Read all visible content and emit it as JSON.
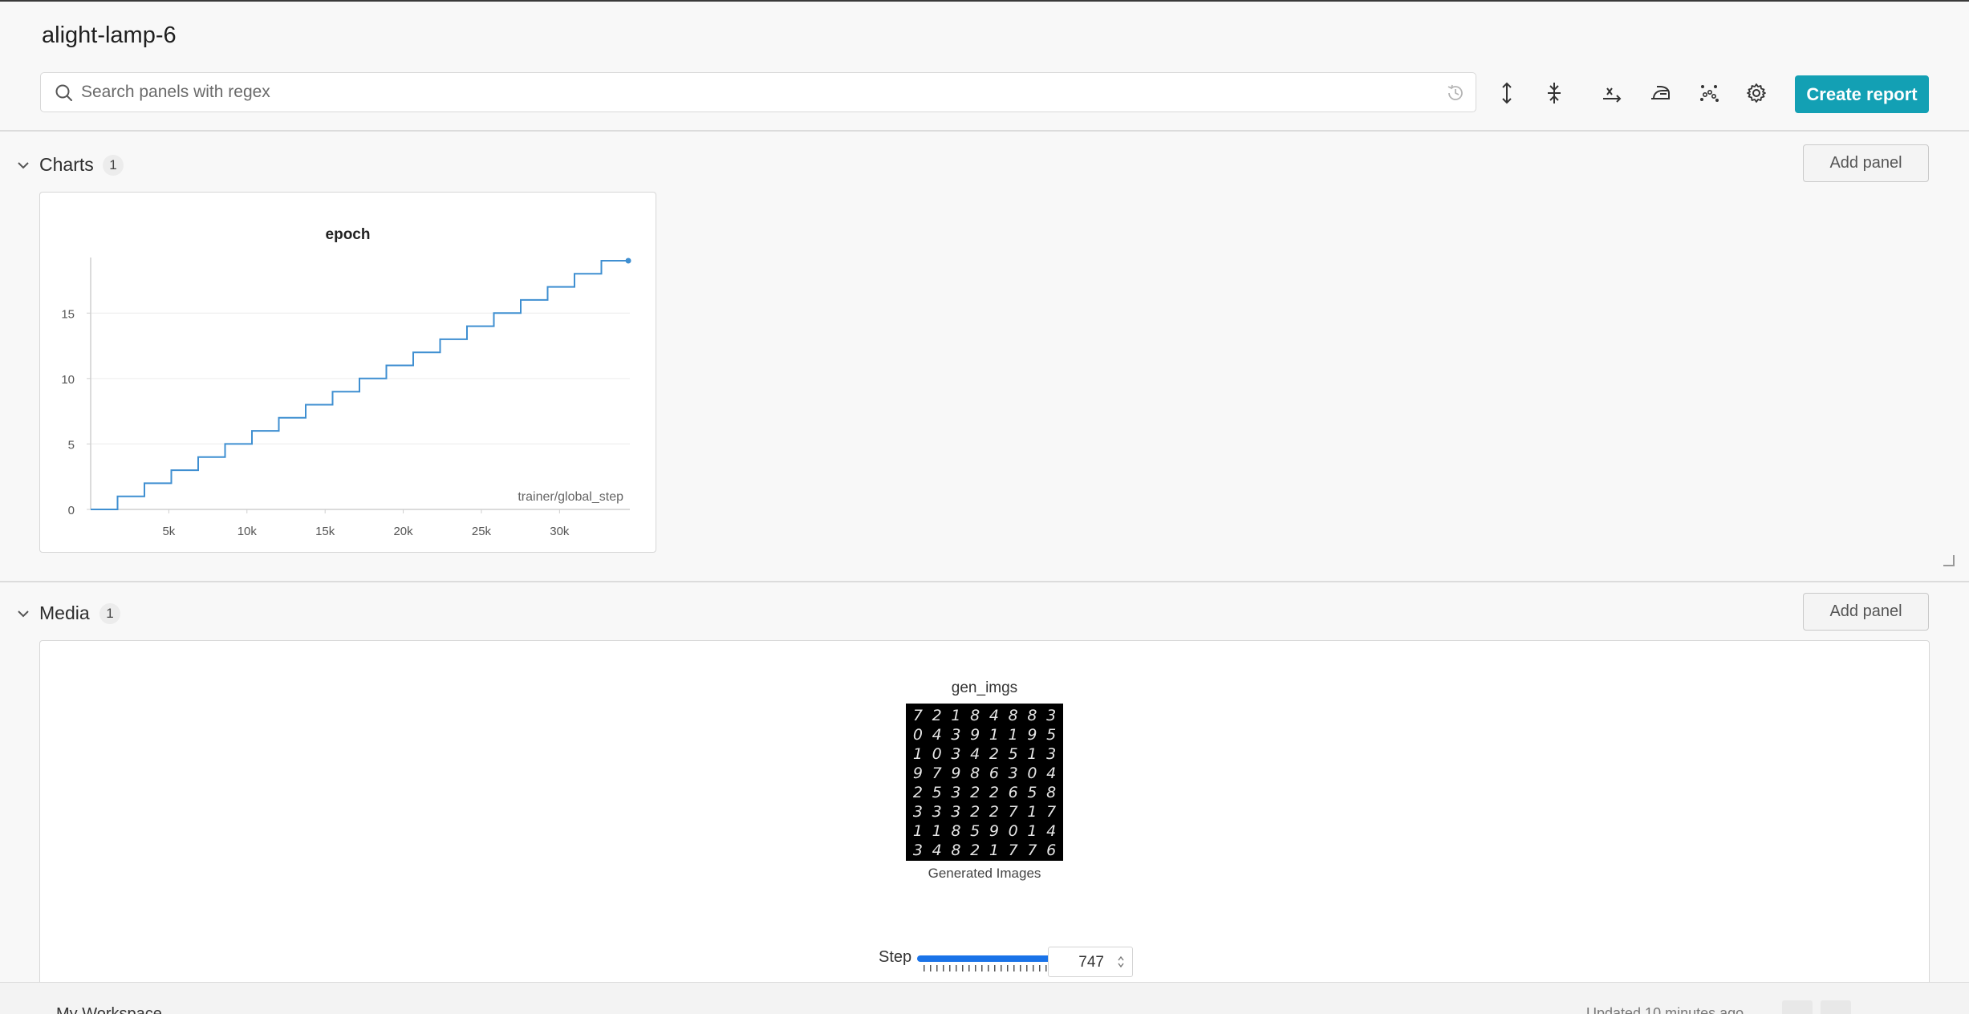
{
  "header": {
    "run_name": "alight-lamp-6",
    "search_placeholder": "Search panels with regex",
    "create_report_label": "Create report",
    "toolbar_icons": [
      "history-icon",
      "expand-vertical-icon",
      "collapse-vertical-icon",
      "x-axis-icon",
      "smoothing-iron-icon",
      "outliers-icon",
      "settings-icon"
    ]
  },
  "sections": {
    "charts": {
      "title": "Charts",
      "count": "1",
      "add_panel_label": "Add panel"
    },
    "media": {
      "title": "Media",
      "count": "1",
      "add_panel_label": "Add panel"
    }
  },
  "chart": {
    "title": "epoch",
    "x_label": "trainer/global_step",
    "x_ticks": [
      "5k",
      "10k",
      "15k",
      "20k",
      "25k",
      "30k"
    ],
    "y_ticks": [
      "0",
      "5",
      "10",
      "15"
    ]
  },
  "chart_data": {
    "type": "line",
    "title": "epoch",
    "xlabel": "trainer/global_step",
    "ylabel": "",
    "xlim": [
      0,
      34500
    ],
    "ylim": [
      0,
      19
    ],
    "x_ticks": [
      5000,
      10000,
      15000,
      20000,
      25000,
      30000
    ],
    "y_ticks": [
      0,
      5,
      10,
      15
    ],
    "grid": true,
    "series": [
      {
        "color": "#3f8fd1",
        "x": [
          0,
          1720,
          1720,
          3440,
          3440,
          5160,
          5160,
          6880,
          6880,
          8600,
          8600,
          10320,
          10320,
          12040,
          12040,
          13760,
          13760,
          15480,
          15480,
          17200,
          17200,
          18920,
          18920,
          20640,
          20640,
          22360,
          22360,
          24080,
          24080,
          25800,
          25800,
          27520,
          27520,
          29240,
          29240,
          30960,
          30960,
          32680,
          32680,
          34400
        ],
        "y": [
          0,
          0,
          1,
          1,
          2,
          2,
          3,
          3,
          4,
          4,
          5,
          5,
          6,
          6,
          7,
          7,
          8,
          8,
          9,
          9,
          10,
          10,
          11,
          11,
          12,
          12,
          13,
          13,
          14,
          14,
          15,
          15,
          16,
          16,
          17,
          17,
          18,
          18,
          19,
          19
        ]
      }
    ]
  },
  "media": {
    "panel_name": "gen_imgs",
    "caption": "Generated Images",
    "step_label": "Step",
    "step_value": "747",
    "slider_fraction": 1.0,
    "digit_rows": [
      [
        "7",
        "2",
        "1",
        "8",
        "4",
        "8",
        "8",
        "3"
      ],
      [
        "0",
        "4",
        "3",
        "9",
        "1",
        "1",
        "9",
        "5"
      ],
      [
        "1",
        "0",
        "3",
        "4",
        "2",
        "5",
        "1",
        "3"
      ],
      [
        "9",
        "7",
        "9",
        "8",
        "6",
        "3",
        "0",
        "4"
      ],
      [
        "2",
        "5",
        "3",
        "2",
        "2",
        "6",
        "5",
        "8"
      ],
      [
        "3",
        "3",
        "3",
        "2",
        "2",
        "7",
        "1",
        "7"
      ],
      [
        "1",
        "1",
        "8",
        "5",
        "9",
        "0",
        "1",
        "4"
      ],
      [
        "3",
        "4",
        "8",
        "2",
        "1",
        "7",
        "7",
        "6"
      ]
    ]
  },
  "footer": {
    "workspace_label": "My Workspace",
    "updated_text": "Updated 10 minutes ago"
  }
}
